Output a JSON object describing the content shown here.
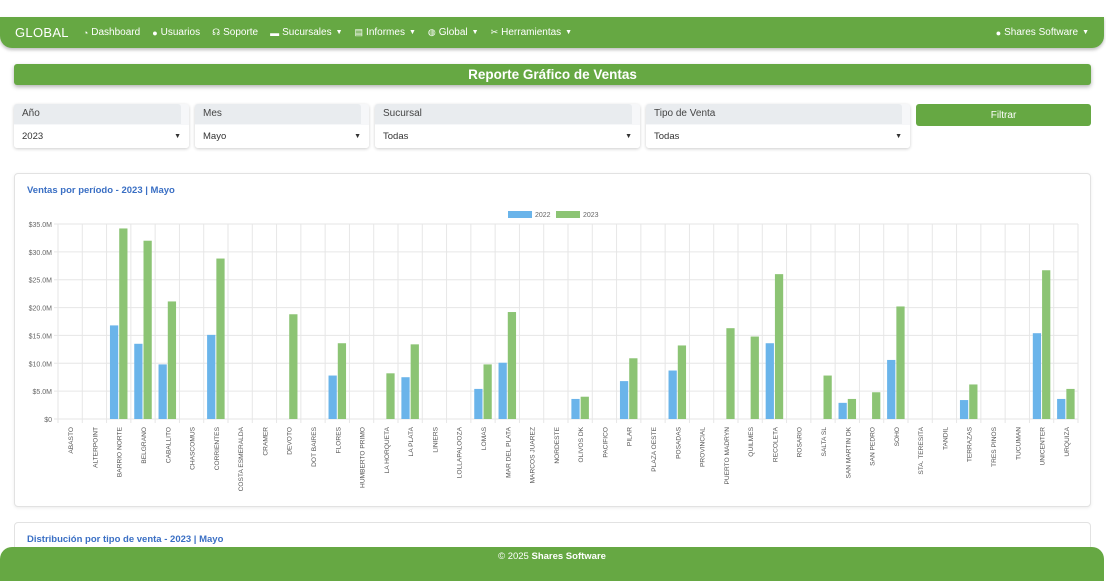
{
  "navbar": {
    "brand": "GLOBAL",
    "items": [
      {
        "label": "Dashboard",
        "icon": "dashboard-icon",
        "dropdown": false
      },
      {
        "label": "Usuarios",
        "icon": "user-icon",
        "dropdown": false
      },
      {
        "label": "Soporte",
        "icon": "support-icon",
        "dropdown": false
      },
      {
        "label": "Sucursales",
        "icon": "store-icon",
        "dropdown": true
      },
      {
        "label": "Informes",
        "icon": "file-icon",
        "dropdown": true
      },
      {
        "label": "Global",
        "icon": "globe-icon",
        "dropdown": true
      },
      {
        "label": "Herramientas",
        "icon": "tools-icon",
        "dropdown": true
      }
    ],
    "account": "Shares Software"
  },
  "page_title": "Reporte Gráfico de Ventas",
  "filters": {
    "year": {
      "label": "Año",
      "value": "2023"
    },
    "month": {
      "label": "Mes",
      "value": "Mayo"
    },
    "branch": {
      "label": "Sucursal",
      "value": "Todas"
    },
    "sale_type": {
      "label": "Tipo de Venta",
      "value": "Todas"
    },
    "button": "Filtrar"
  },
  "chart_card_title": "Ventas por período - 2023 | Mayo",
  "distribution_card_title": "Distribución por tipo de venta - 2023 | Mayo",
  "footer": {
    "prefix": "© 2025 ",
    "brand": "Shares Software"
  },
  "colors": {
    "accent": "#66a843",
    "series_2022": "#6ab4ea",
    "series_2023": "#8cc474",
    "link": "#3a6fc4"
  },
  "chart_data": {
    "type": "bar",
    "title": "",
    "xlabel": "",
    "ylabel": "",
    "ylim": [
      0,
      35
    ],
    "y_ticks": [
      "$0",
      "$5.0M",
      "$10.0M",
      "$15.0M",
      "$20.0M",
      "$25.0M",
      "$30.0M",
      "$35.0M"
    ],
    "legend_position": "top-center",
    "grid": true,
    "categories": [
      "ABASTO",
      "ALTERPOINT",
      "BARRIO NORTE",
      "BELGRANO",
      "CABALLITO",
      "CHASCOMUS",
      "CORRIENTES",
      "COSTA ESMERALDA",
      "CRAMER",
      "DEVOTO",
      "DOT BAIRES",
      "FLORES",
      "HUMBERTO PRIMO",
      "LA HORQUETA",
      "LA PLATA",
      "LINIERS",
      "LOLLAPALOOZA",
      "LOMAS",
      "MAR DEL PLATA",
      "MARCOS JUAREZ",
      "NORDESTE",
      "OLIVOS DK",
      "PACIFICO",
      "PILAR",
      "PLAZA OESTE",
      "POSADAS",
      "PROVINCIAL",
      "PUERTO MADRYN",
      "QUILMES",
      "RECOLETA",
      "ROSARIO",
      "SALTA SL",
      "SAN MARTIN DK",
      "SAN PEDRO",
      "SOHO",
      "STA. TERESITA",
      "TANDIL",
      "TERRAZAS",
      "TRES PINOS",
      "TUCUMAN",
      "UNICENTER",
      "URQUIZA"
    ],
    "series": [
      {
        "name": "2022",
        "values": [
          0,
          0,
          16.8,
          13.5,
          9.8,
          0,
          15.1,
          0,
          0,
          0,
          0,
          7.8,
          0,
          0,
          7.5,
          0,
          0,
          5.4,
          10.1,
          0,
          0,
          3.6,
          0,
          6.8,
          0,
          8.7,
          0,
          0,
          0,
          13.6,
          0,
          0,
          2.9,
          0,
          10.6,
          0,
          0,
          3.4,
          0,
          0,
          15.4,
          3.6
        ]
      },
      {
        "name": "2023",
        "values": [
          0,
          0,
          34.2,
          32.0,
          21.1,
          0,
          28.8,
          0,
          0,
          18.8,
          0,
          13.6,
          0,
          8.2,
          13.4,
          0,
          0,
          9.8,
          19.2,
          0,
          0,
          4.0,
          0,
          10.9,
          0,
          13.2,
          0,
          16.3,
          14.8,
          26.0,
          0,
          7.8,
          3.6,
          4.8,
          20.2,
          0,
          0,
          6.2,
          0,
          0,
          26.7,
          5.4
        ]
      }
    ]
  }
}
